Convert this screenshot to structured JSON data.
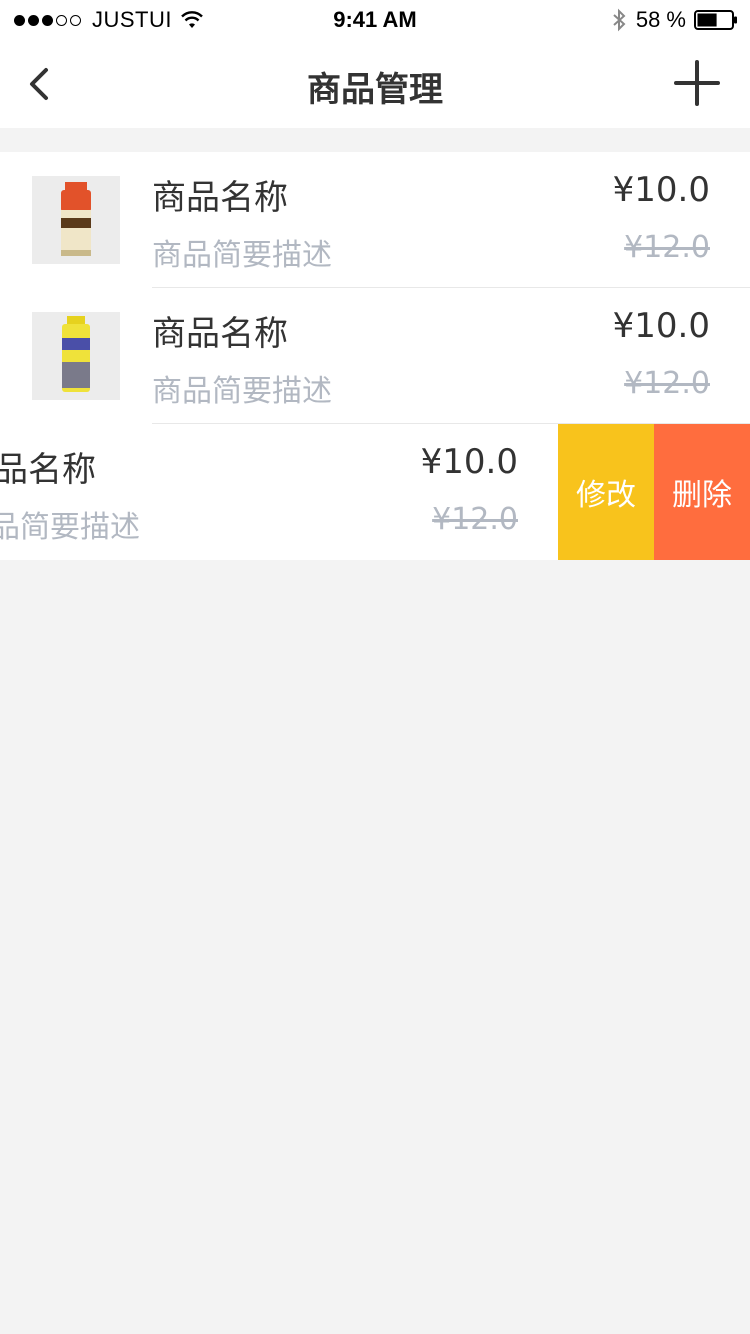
{
  "status_bar": {
    "carrier": "JUSTUI",
    "time": "9:41 AM",
    "battery_percent": "58 %",
    "battery_level": 0.58,
    "signal_bars_filled": 3,
    "signal_bars_total": 5
  },
  "nav": {
    "title": "商品管理",
    "back_icon": "chevron-left-icon",
    "add_icon": "plus-icon"
  },
  "products": [
    {
      "name": "商品名称",
      "description": "商品简要描述",
      "price": "¥10.0",
      "original_price": "¥12.0"
    },
    {
      "name": "商品名称",
      "description": "商品简要描述",
      "price": "¥10.0",
      "original_price": "¥12.0"
    },
    {
      "name": "商品名称",
      "description": "商品简要描述",
      "price": "¥10.0",
      "original_price": "¥12.0"
    }
  ],
  "swipe_actions": {
    "edit_label": "修改",
    "delete_label": "删除",
    "edit_color": "#f8c31c",
    "delete_color": "#ff6d3e"
  }
}
